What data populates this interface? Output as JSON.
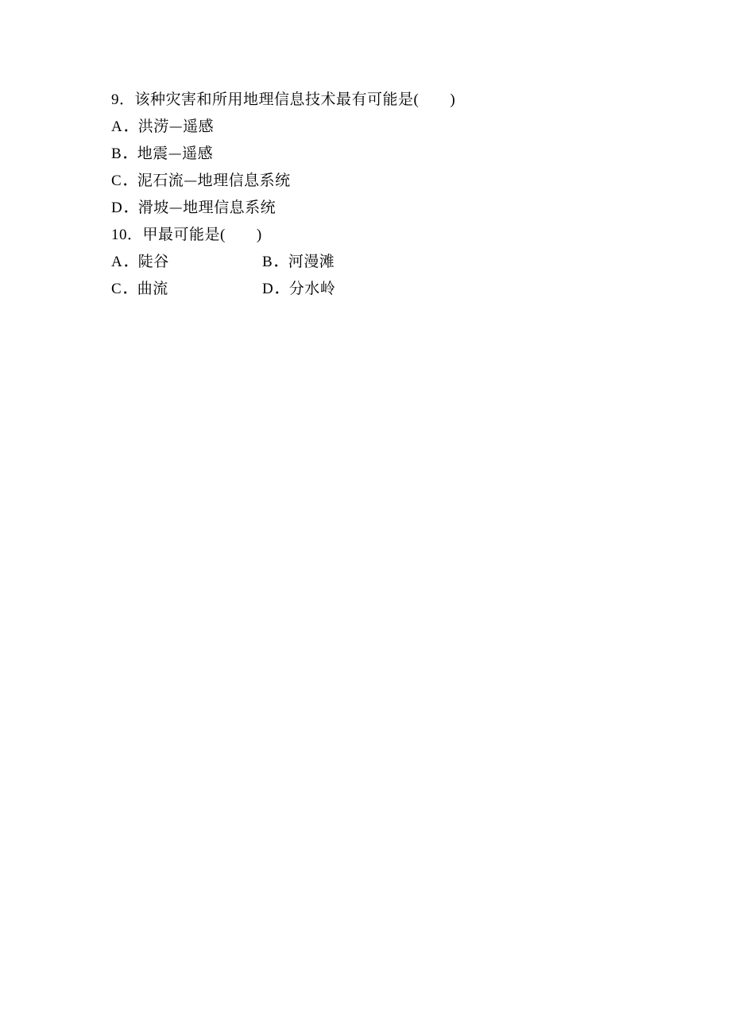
{
  "q9": {
    "number": "9",
    "stem": "该种灾害和所用地理信息技术最有可能是",
    "optA_letter": "A．",
    "optA_text": "洪涝—遥感",
    "optB_letter": "B．",
    "optB_text": "地震—遥感",
    "optC_letter": "C．",
    "optC_text": "泥石流—地理信息系统",
    "optD_letter": "D．",
    "optD_text": "滑坡—地理信息系统"
  },
  "q10": {
    "number": "10",
    "stem": "甲最可能是",
    "optA_letter": "A．",
    "optA_text": "陡谷",
    "optB_letter": "B．",
    "optB_text": "河漫滩",
    "optC_letter": "C．",
    "optC_text": "曲流",
    "optD_letter": "D．",
    "optD_text": "分水岭"
  }
}
